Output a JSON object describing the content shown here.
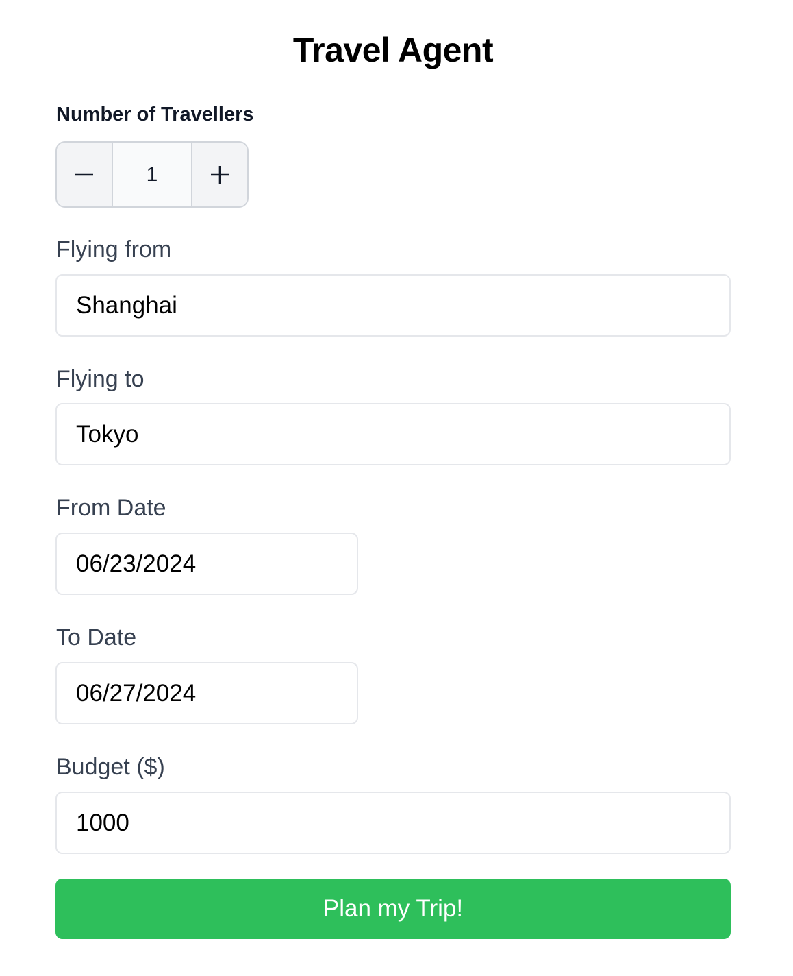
{
  "title": "Travel Agent",
  "travellers": {
    "label": "Number of Travellers",
    "value": "1",
    "decrement_icon": "minus-icon",
    "increment_icon": "plus-icon"
  },
  "flying_from": {
    "label": "Flying from",
    "value": "Shanghai"
  },
  "flying_to": {
    "label": "Flying to",
    "value": "Tokyo"
  },
  "from_date": {
    "label": "From Date",
    "value": "06/23/2024"
  },
  "to_date": {
    "label": "To Date",
    "value": "06/27/2024"
  },
  "budget": {
    "label": "Budget ($)",
    "value": "1000"
  },
  "submit": {
    "label": "Plan my Trip!",
    "color": "#2ebf5b"
  }
}
